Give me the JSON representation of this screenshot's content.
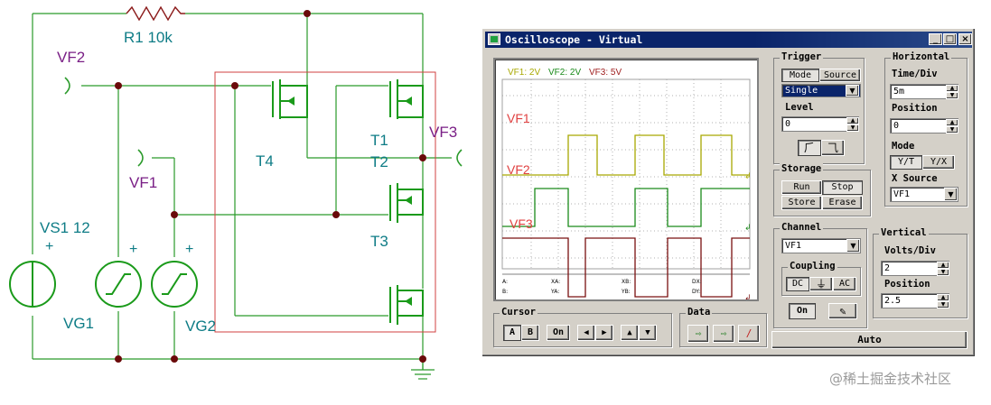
{
  "schematic": {
    "resistor_label": "R1 10k",
    "vf2_label": "VF2",
    "vf1_label": "VF1",
    "vf3_label": "VF3",
    "t4_label": "T4",
    "t1_label": "T1",
    "t2_label": "T2",
    "t3_label": "T3",
    "vs1_label": "VS1 12",
    "vg1_label": "VG1",
    "vg2_label": "VG2",
    "plus_sign": "+"
  },
  "window": {
    "title": "Oscilloscope - Virtual",
    "min_label": "_",
    "max_label": "□",
    "close_label": "×"
  },
  "screen": {
    "header_vf1": "VF1: 2V",
    "header_vf2": "VF2: 2V",
    "header_vf3": "VF3: 5V",
    "trace1_label": "VF1",
    "trace2_label": "VF2",
    "trace3_label": "VF3",
    "readouts": [
      "A:",
      "XA:",
      "XB:",
      "DX:",
      "B:",
      "YA:",
      "YB:",
      "DY:"
    ]
  },
  "trigger": {
    "title": "Trigger",
    "mode_label": "Mode",
    "source_label": "Source",
    "mode_value": "Single",
    "level_label": "Level",
    "level_value": "0"
  },
  "horizontal": {
    "title": "Horizontal",
    "timediv_label": "Time/Div",
    "timediv_value": "5m",
    "position_label": "Position",
    "position_value": "0",
    "mode_label": "Mode",
    "yt_label": "Y/T",
    "yx_label": "Y/X",
    "xsource_label": "X Source",
    "xsource_value": "VF1"
  },
  "storage": {
    "title": "Storage",
    "run_label": "Run",
    "stop_label": "Stop",
    "store_label": "Store",
    "erase_label": "Erase"
  },
  "channel": {
    "title": "Channel",
    "value": "VF1",
    "coupling_label": "Coupling",
    "dc_label": "DC",
    "ac_label": "AC",
    "on_label": "On"
  },
  "vertical": {
    "title": "Vertical",
    "voltsdiv_label": "Volts/Div",
    "voltsdiv_value": "2",
    "position_label": "Position",
    "position_value": "2.5"
  },
  "cursor": {
    "title": "Cursor",
    "a_label": "A",
    "b_label": "B",
    "on_label": "On"
  },
  "data_group": {
    "title": "Data"
  },
  "auto_label": "Auto",
  "watermark": "@稀土掘金技术社区",
  "colors": {
    "trace_vf1": "#a8a800",
    "trace_vf2": "#1a8a1a",
    "trace_vf3": "#7a1010",
    "label_vf1": "#e04040",
    "wire": "#2a9a2a",
    "net": "#8b1a1a",
    "teal": "#0e7c86",
    "purple": "#7a1f86",
    "title_bar": "#0a246a"
  }
}
